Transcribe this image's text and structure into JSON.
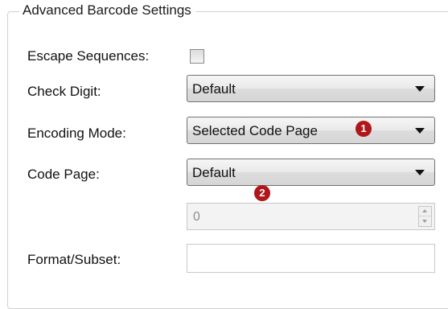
{
  "group": {
    "title": "Advanced Barcode Settings"
  },
  "fields": {
    "escape_sequences": {
      "label": "Escape Sequences:",
      "checked": false
    },
    "check_digit": {
      "label": "Check Digit:",
      "value": "Default"
    },
    "encoding_mode": {
      "label": "Encoding Mode:",
      "value": "Selected Code Page"
    },
    "code_page": {
      "label": "Code Page:",
      "value": "Default",
      "spinner_value": "0"
    },
    "format_subset": {
      "label": "Format/Subset:",
      "value": ""
    }
  },
  "callouts": {
    "first": "1",
    "second": "2"
  },
  "colors": {
    "callout": "#b0171a",
    "combo_border": "#707070",
    "disabled_bg": "#f3f3f3"
  }
}
